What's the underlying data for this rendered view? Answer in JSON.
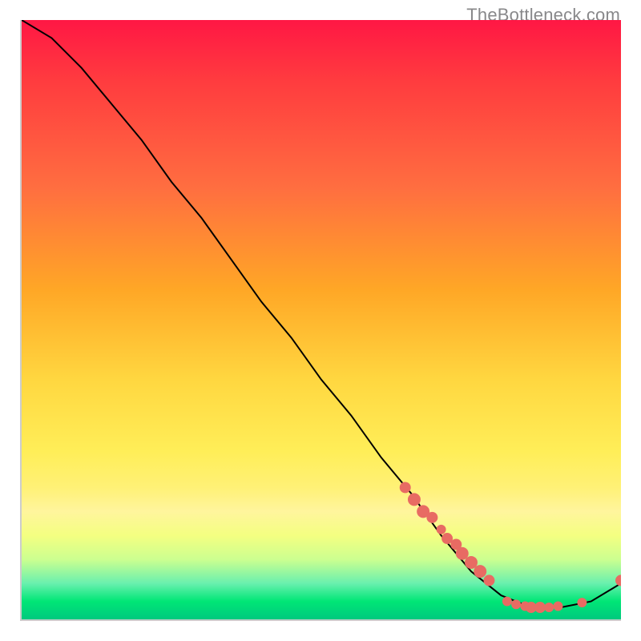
{
  "watermark": "TheBottleneck.com",
  "chart_data": {
    "type": "line",
    "title": "",
    "xlabel": "",
    "ylabel": "",
    "xlim": [
      0,
      100
    ],
    "ylim": [
      0,
      100
    ],
    "grid": false,
    "series": [
      {
        "name": "bottleneck-curve",
        "color": "#000000",
        "x": [
          0,
          5,
          10,
          15,
          20,
          25,
          30,
          35,
          40,
          45,
          50,
          55,
          60,
          65,
          70,
          75,
          80,
          85,
          90,
          95,
          100
        ],
        "values": [
          100,
          97,
          92,
          86,
          80,
          73,
          67,
          60,
          53,
          47,
          40,
          34,
          27,
          21,
          14,
          8,
          4,
          2,
          2,
          3,
          6
        ]
      }
    ],
    "optimal_zone_y": [
      0,
      8
    ],
    "markers": [
      {
        "x": 64,
        "y": 22,
        "r": 7
      },
      {
        "x": 65.5,
        "y": 20,
        "r": 8
      },
      {
        "x": 67,
        "y": 18,
        "r": 8
      },
      {
        "x": 68.5,
        "y": 17,
        "r": 7
      },
      {
        "x": 70,
        "y": 15,
        "r": 6
      },
      {
        "x": 71,
        "y": 13.5,
        "r": 7
      },
      {
        "x": 72.5,
        "y": 12.5,
        "r": 7
      },
      {
        "x": 73.5,
        "y": 11,
        "r": 8
      },
      {
        "x": 75,
        "y": 9.5,
        "r": 8
      },
      {
        "x": 76.5,
        "y": 8,
        "r": 8
      },
      {
        "x": 78,
        "y": 6.5,
        "r": 7
      },
      {
        "x": 81,
        "y": 3,
        "r": 6
      },
      {
        "x": 82.5,
        "y": 2.5,
        "r": 6
      },
      {
        "x": 84,
        "y": 2.2,
        "r": 6
      },
      {
        "x": 85,
        "y": 2.0,
        "r": 7
      },
      {
        "x": 86.5,
        "y": 2.0,
        "r": 7
      },
      {
        "x": 88,
        "y": 2.0,
        "r": 6
      },
      {
        "x": 89.5,
        "y": 2.2,
        "r": 6
      },
      {
        "x": 93.5,
        "y": 2.8,
        "r": 6
      },
      {
        "x": 100,
        "y": 6.5,
        "r": 7
      }
    ],
    "marker_color": "#e86b63"
  }
}
